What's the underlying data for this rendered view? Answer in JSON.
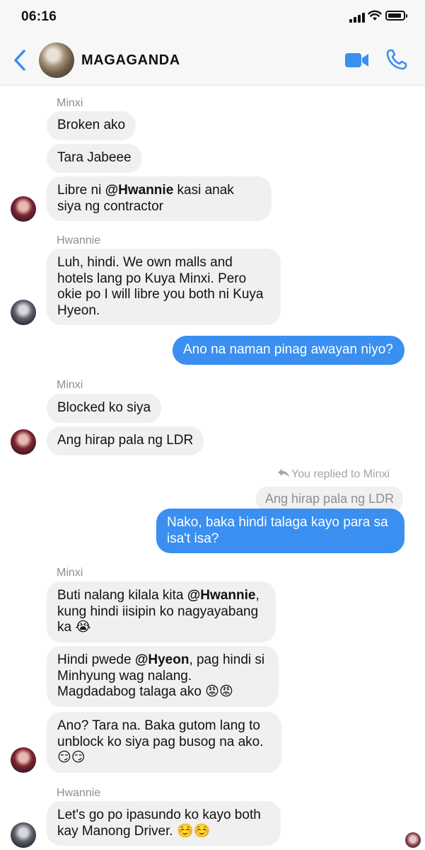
{
  "status_bar": {
    "time": "06:16"
  },
  "header": {
    "title": "MAGAGANDA"
  },
  "icons": {
    "back": "chevron-left-icon",
    "video": "video-camera-icon",
    "call": "phone-icon",
    "accent_color": "#3a8ff0"
  },
  "messages": {
    "s1": {
      "sender": "Minxi"
    },
    "m1": "Broken ako",
    "m2": "Tara Jabeee",
    "m3": {
      "pre": "Libre ni ",
      "mention": "@Hwannie",
      "post": " kasi anak siya ng contractor"
    },
    "s2": {
      "sender": "Hwannie"
    },
    "m4": "Luh, hindi. We own malls and hotels lang po Kuya Minxi. Pero okie po I will libre you both ni Kuya Hyeon.",
    "m5": "Ano na naman pinag awayan niyo?",
    "s3": {
      "sender": "Minxi"
    },
    "m6": "Blocked ko siya",
    "m7": "Ang hirap pala ng LDR",
    "reply_note": "You replied to Minxi",
    "quoted": "Ang hirap pala ng LDR",
    "m8": "Nako, baka hindi talaga kayo para sa isa't isa?",
    "s4": {
      "sender": "Minxi"
    },
    "m9": {
      "pre": "Buti nalang kilala kita ",
      "mention": "@Hwannie",
      "post": ", kung hindi iisipin ko nagyayabang ka 😭"
    },
    "m10": {
      "pre": "Hindi pwede ",
      "mention": "@Hyeon",
      "post": ", pag hindi si Minhyung wag nalang. Magdadabog talaga ako 😡😡"
    },
    "m11": "Ano? Tara na. Baka gutom lang to unblock ko siya pag busog na ako. 😏😏",
    "s5": {
      "sender": "Hwannie"
    },
    "m12": "Let's go po ipasundo ko kayo both kay Manong Driver. ☺️☺️"
  }
}
